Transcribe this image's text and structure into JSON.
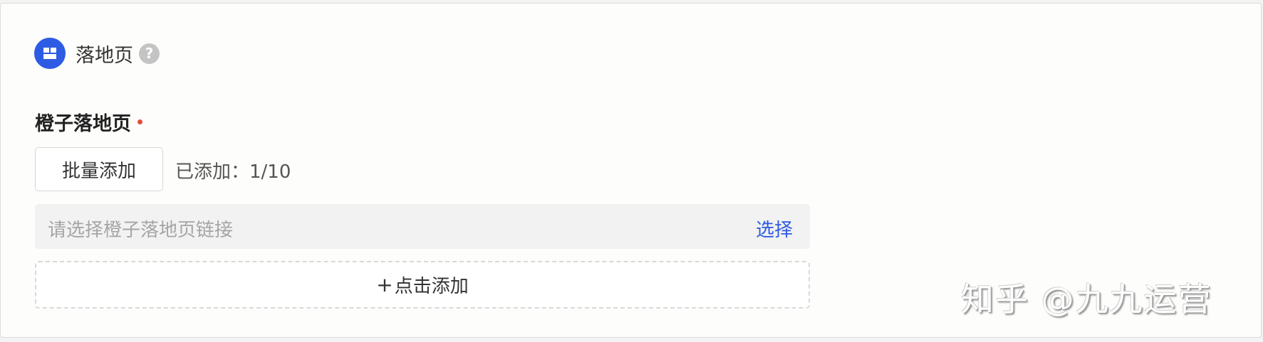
{
  "section": {
    "title": "落地页",
    "icon": "layout-grid-icon",
    "help_icon": "question-circle-icon",
    "help_glyph": "?"
  },
  "field": {
    "label": "橙子落地页",
    "required": true
  },
  "batch_add": {
    "label": "批量添加",
    "count_text": "已添加：1/10"
  },
  "link_input": {
    "placeholder": "请选择橙子落地页链接",
    "select_label": "选择"
  },
  "add_row": {
    "plus": "+",
    "label": "点击添加"
  },
  "watermark": {
    "text": "知乎 @九九运营"
  },
  "colors": {
    "accent": "#2d5be3",
    "required": "#e64b3c",
    "input_bg": "#f2f2f2"
  }
}
